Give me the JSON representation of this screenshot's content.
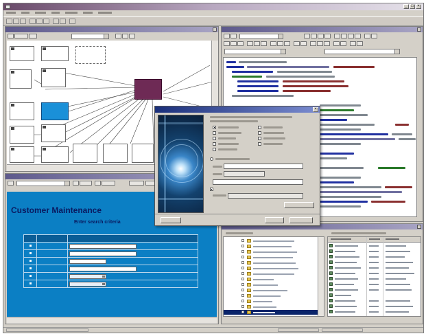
{
  "browser": {
    "page_title": "Customer Maintenance",
    "subtitle": "Enter search criteria",
    "columns": [
      "",
      ""
    ],
    "rows": [
      {
        "label": "",
        "control": "text-wide"
      },
      {
        "label": "",
        "control": "text-wide"
      },
      {
        "label": "",
        "control": "text-medium"
      },
      {
        "label": "",
        "control": "text-wide"
      },
      {
        "label": "",
        "control": "select"
      },
      {
        "label": "",
        "control": "select"
      }
    ],
    "background_color": "#0b7fc4",
    "title_color": "#0a1a60"
  },
  "dialog": {
    "buttons": [
      "",
      "",
      ""
    ],
    "icons": [
      "artwork-orb-icon"
    ]
  },
  "icons": [
    "app-icon",
    "minimize-icon",
    "maximize-icon",
    "close-icon",
    "folder-icon",
    "file-icon"
  ],
  "colors": {
    "title_gradient_start": "#6a4a6a",
    "panel_title": "#5e5a8c",
    "dialog_title": "#1a2f7a",
    "selected_node": "#1a90d8",
    "entity_node": "#6e2a55"
  }
}
